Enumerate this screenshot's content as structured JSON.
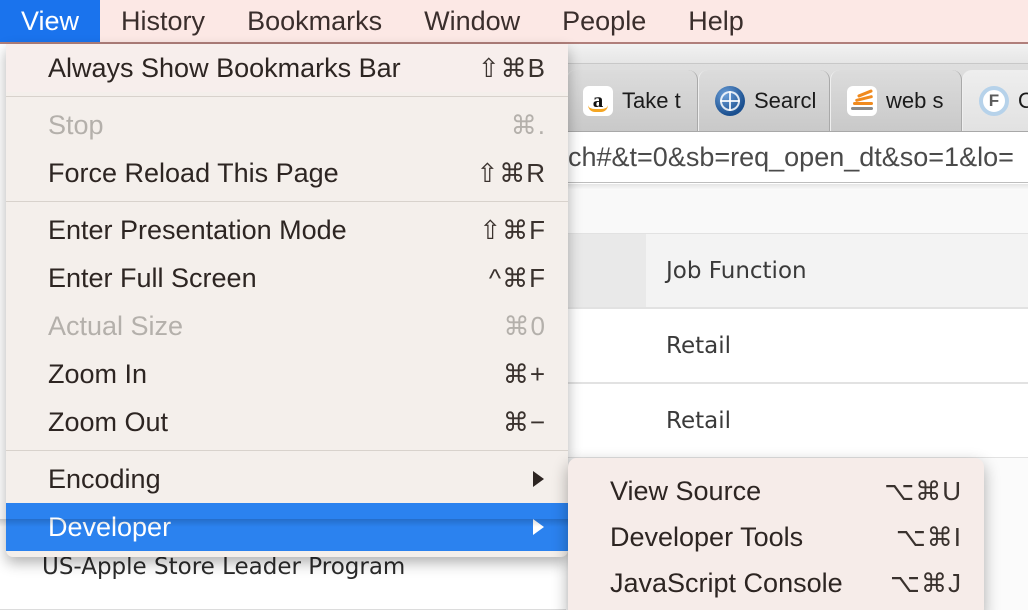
{
  "menubar": {
    "items": [
      {
        "label": "View",
        "active": true
      },
      {
        "label": "History",
        "active": false
      },
      {
        "label": "Bookmarks",
        "active": false
      },
      {
        "label": "Window",
        "active": false
      },
      {
        "label": "People",
        "active": false
      },
      {
        "label": "Help",
        "active": false
      }
    ],
    "background_color": "#fce8e5",
    "active_color": "#1a73ed"
  },
  "view_menu": {
    "groups": [
      {
        "items": [
          {
            "label": "Always Show Bookmarks Bar",
            "shortcut": "⇧⌘B",
            "disabled": false,
            "submenu": false,
            "highlight": false
          }
        ]
      },
      {
        "items": [
          {
            "label": "Stop",
            "shortcut": "⌘.",
            "disabled": true,
            "submenu": false,
            "highlight": false
          },
          {
            "label": "Force Reload This Page",
            "shortcut": "⇧⌘R",
            "disabled": false,
            "submenu": false,
            "highlight": false
          }
        ]
      },
      {
        "items": [
          {
            "label": "Enter Presentation Mode",
            "shortcut": "⇧⌘F",
            "disabled": false,
            "submenu": false,
            "highlight": false
          },
          {
            "label": "Enter Full Screen",
            "shortcut": "^⌘F",
            "disabled": false,
            "submenu": false,
            "highlight": false
          },
          {
            "label": "Actual Size",
            "shortcut": "⌘0",
            "disabled": true,
            "submenu": false,
            "highlight": false
          },
          {
            "label": "Zoom In",
            "shortcut": "⌘+",
            "disabled": false,
            "submenu": false,
            "highlight": false
          },
          {
            "label": "Zoom Out",
            "shortcut": "⌘−",
            "disabled": false,
            "submenu": false,
            "highlight": false
          }
        ]
      },
      {
        "items": [
          {
            "label": "Encoding",
            "shortcut": "",
            "disabled": false,
            "submenu": true,
            "highlight": false
          },
          {
            "label": "Developer",
            "shortcut": "",
            "disabled": false,
            "submenu": true,
            "highlight": true
          }
        ]
      }
    ]
  },
  "developer_submenu": {
    "items": [
      {
        "label": "View Source",
        "shortcut": "⌥⌘U"
      },
      {
        "label": "Developer Tools",
        "shortcut": "⌥⌘I"
      },
      {
        "label": "JavaScript Console",
        "shortcut": "⌥⌘J"
      }
    ]
  },
  "browser": {
    "tabs": [
      {
        "label": "Take t",
        "icon": "amazon-icon",
        "active": false
      },
      {
        "label": "Searcl",
        "icon": "globe-icon",
        "active": false
      },
      {
        "label": "web s",
        "icon": "feed-icon",
        "active": false
      },
      {
        "label": "Op",
        "icon": "f-circle-icon",
        "active": true
      }
    ],
    "url": "ch#&t=0&sb=req_open_dt&so=1&lo="
  },
  "page_content": {
    "rows": [
      {
        "text": "Job Function",
        "header": true
      },
      {
        "text": "Retail",
        "header": false
      },
      {
        "text": "Retail",
        "header": false
      }
    ],
    "footer_label": "US-Apple Store Leader Program"
  }
}
